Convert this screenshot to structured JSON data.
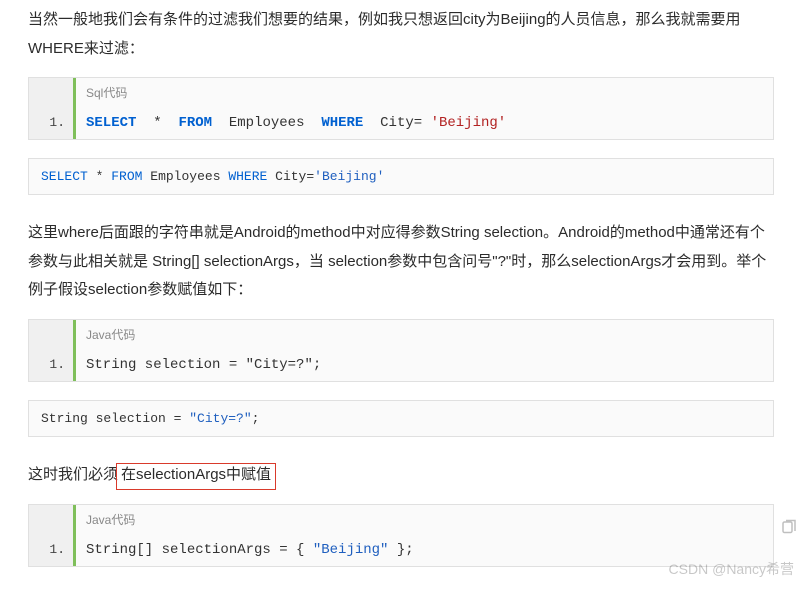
{
  "paragraphs": {
    "p1": "当然一般地我们会有条件的过滤我们想要的结果，例如我只想返回city为Beijing的人员信息，那么我就需要用WHERE来过滤：",
    "p2": "这里where后面跟的字符串就是Android的method中对应得参数String selection。Android的method中通常还有个参数与此相关就是 String[] selectionArgs，当 selection参数中包含问号\"?\"时，那么selectionArgs才会用到。举个例子假设selection参数赋值如下：",
    "p3_before": "这时我们必须",
    "p3_box": "在selectionArgs中赋值"
  },
  "code_blocks": {
    "sql_titled": {
      "lang": "Sql代码",
      "line_no": "1.",
      "tokens": {
        "select": "SELECT",
        "star": "*",
        "from": "FROM",
        "table": "Employees",
        "where": "WHERE",
        "col_eq": "City=",
        "lit": "'Beijing'"
      }
    },
    "sql_plain": {
      "tokens": {
        "select": "SELECT",
        "star": "*",
        "from": "FROM",
        "table": "Employees",
        "where": "WHERE",
        "col_eq": "City=",
        "lit": "'Beijing'"
      }
    },
    "java1_titled": {
      "lang": "Java代码",
      "line_no": "1.",
      "text_before": "String selection = ",
      "str_lit": "\"City=?\"",
      "text_after": ";"
    },
    "java1_plain": {
      "text_before": "String selection = ",
      "str_lit": "\"City=?\"",
      "text_after": ";"
    },
    "java2_titled": {
      "lang": "Java代码",
      "line_no": "1.",
      "text_before": "String[] selectionArgs = { ",
      "str_lit": "\"Beijing\"",
      "text_after": " };"
    }
  },
  "watermark": "CSDN @Nancy希营"
}
